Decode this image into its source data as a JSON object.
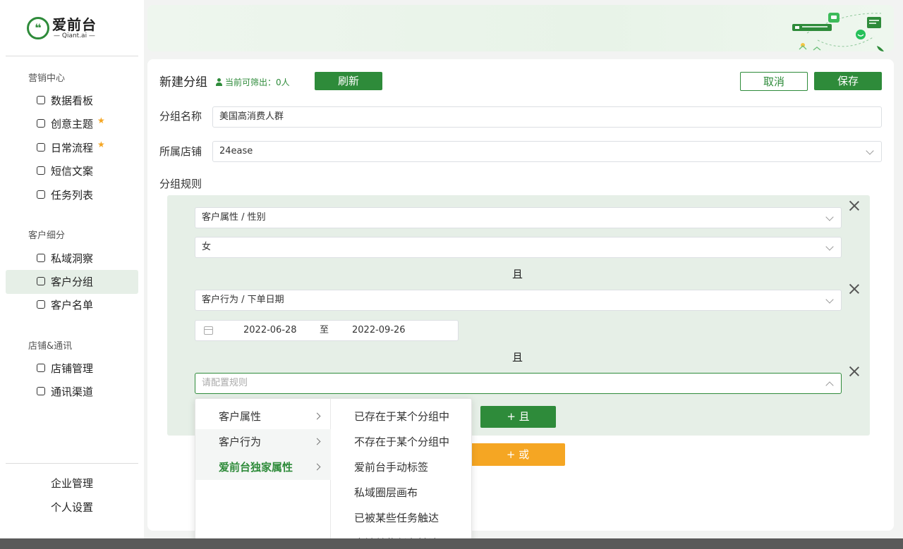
{
  "brand": {
    "name": "爱前台",
    "sub": "— Qiant.ai —",
    "badge": "❝"
  },
  "sidebar": {
    "sections": [
      {
        "title": "营销中心",
        "items": [
          {
            "label": "数据看板",
            "icon": "dashboard-icon",
            "star": false
          },
          {
            "label": "创意主题",
            "icon": "image-icon",
            "star": true
          },
          {
            "label": "日常流程",
            "icon": "flow-icon",
            "star": true
          },
          {
            "label": "短信文案",
            "icon": "message-icon",
            "star": false
          },
          {
            "label": "任务列表",
            "icon": "task-icon",
            "star": false
          }
        ]
      },
      {
        "title": "客户细分",
        "items": [
          {
            "label": "私域洞察",
            "icon": "insight-icon",
            "star": false
          },
          {
            "label": "客户分组",
            "icon": "group-icon",
            "star": false,
            "active": true
          },
          {
            "label": "客户名单",
            "icon": "list-icon",
            "star": false
          }
        ]
      },
      {
        "title": "店铺&通讯",
        "items": [
          {
            "label": "店铺管理",
            "icon": "shop-icon",
            "star": false
          },
          {
            "label": "通讯渠道",
            "icon": "channel-icon",
            "star": false
          }
        ]
      }
    ],
    "bottom": [
      "企业管理",
      "个人设置"
    ],
    "star_icon": "★"
  },
  "main": {
    "title": "新建分组",
    "count_text": "当前可筛出：0人",
    "refresh_label": "刷新",
    "cancel_label": "取消",
    "save_label": "保存",
    "name_label": "分组名称",
    "name_value": "美国高消费人群",
    "store_label": "所属店铺",
    "store_value": "24ease",
    "rules_label": "分组规则",
    "rules": {
      "r1_attr": "客户属性 / 性别",
      "r1_value": "女",
      "and1": "且",
      "r2_attr": "客户行为 / 下单日期",
      "date_start": "2022-06-28",
      "date_sep": "至",
      "date_end": "2022-09-26",
      "and2": "且",
      "r3_placeholder": "请配置规则",
      "add_and_label": "+ 且",
      "add_or_label": "+ 或"
    }
  },
  "cascader": {
    "level1": [
      "客户属性",
      "客户行为",
      "爱前台独家属性"
    ],
    "level2": [
      "已存在于某个分组中",
      "不存在于某个分组中",
      "爱前台手动标签",
      "私域圈层画布",
      "已被某些任务触达",
      "未被某些任务触达"
    ]
  },
  "colors": {
    "brand_green": "#2e8b3a",
    "accent_orange": "#f5a623",
    "rule_bg": "#e6efe7"
  }
}
